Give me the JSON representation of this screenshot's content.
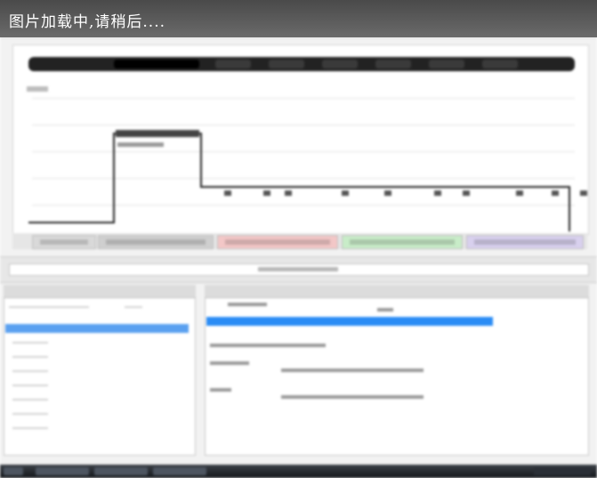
{
  "loading_banner": {
    "text": "图片加载中,请稍后...."
  },
  "chart": {
    "line_color": "#222222",
    "lane_colors": [
      "#d9d9d9",
      "#cfcfcf",
      "#f3c7c7",
      "#c8ecc8",
      "#d8d0ee"
    ]
  },
  "colors": {
    "selection_left": "#5aa0f0",
    "selection_right": "#2a8cf5",
    "toolbar": "#222222",
    "taskbar": "#1e2228"
  },
  "icons": [
    "start-icon",
    "taskbar-app-icon",
    "system-tray-icon"
  ]
}
